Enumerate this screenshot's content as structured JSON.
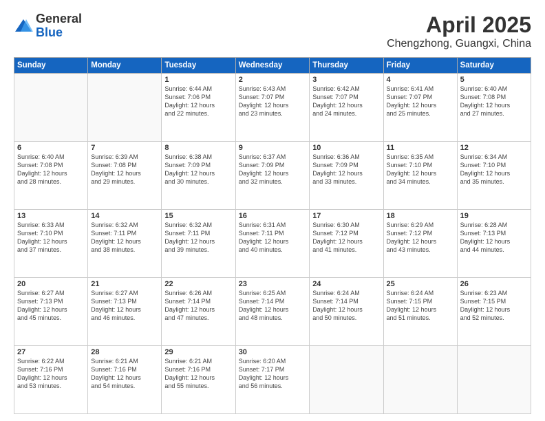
{
  "logo": {
    "general": "General",
    "blue": "Blue"
  },
  "header": {
    "month_year": "April 2025",
    "location": "Chengzhong, Guangxi, China"
  },
  "weekdays": [
    "Sunday",
    "Monday",
    "Tuesday",
    "Wednesday",
    "Thursday",
    "Friday",
    "Saturday"
  ],
  "weeks": [
    [
      {
        "day": "",
        "info": ""
      },
      {
        "day": "",
        "info": ""
      },
      {
        "day": "1",
        "info": "Sunrise: 6:44 AM\nSunset: 7:06 PM\nDaylight: 12 hours\nand 22 minutes."
      },
      {
        "day": "2",
        "info": "Sunrise: 6:43 AM\nSunset: 7:07 PM\nDaylight: 12 hours\nand 23 minutes."
      },
      {
        "day": "3",
        "info": "Sunrise: 6:42 AM\nSunset: 7:07 PM\nDaylight: 12 hours\nand 24 minutes."
      },
      {
        "day": "4",
        "info": "Sunrise: 6:41 AM\nSunset: 7:07 PM\nDaylight: 12 hours\nand 25 minutes."
      },
      {
        "day": "5",
        "info": "Sunrise: 6:40 AM\nSunset: 7:08 PM\nDaylight: 12 hours\nand 27 minutes."
      }
    ],
    [
      {
        "day": "6",
        "info": "Sunrise: 6:40 AM\nSunset: 7:08 PM\nDaylight: 12 hours\nand 28 minutes."
      },
      {
        "day": "7",
        "info": "Sunrise: 6:39 AM\nSunset: 7:08 PM\nDaylight: 12 hours\nand 29 minutes."
      },
      {
        "day": "8",
        "info": "Sunrise: 6:38 AM\nSunset: 7:09 PM\nDaylight: 12 hours\nand 30 minutes."
      },
      {
        "day": "9",
        "info": "Sunrise: 6:37 AM\nSunset: 7:09 PM\nDaylight: 12 hours\nand 32 minutes."
      },
      {
        "day": "10",
        "info": "Sunrise: 6:36 AM\nSunset: 7:09 PM\nDaylight: 12 hours\nand 33 minutes."
      },
      {
        "day": "11",
        "info": "Sunrise: 6:35 AM\nSunset: 7:10 PM\nDaylight: 12 hours\nand 34 minutes."
      },
      {
        "day": "12",
        "info": "Sunrise: 6:34 AM\nSunset: 7:10 PM\nDaylight: 12 hours\nand 35 minutes."
      }
    ],
    [
      {
        "day": "13",
        "info": "Sunrise: 6:33 AM\nSunset: 7:10 PM\nDaylight: 12 hours\nand 37 minutes."
      },
      {
        "day": "14",
        "info": "Sunrise: 6:32 AM\nSunset: 7:11 PM\nDaylight: 12 hours\nand 38 minutes."
      },
      {
        "day": "15",
        "info": "Sunrise: 6:32 AM\nSunset: 7:11 PM\nDaylight: 12 hours\nand 39 minutes."
      },
      {
        "day": "16",
        "info": "Sunrise: 6:31 AM\nSunset: 7:11 PM\nDaylight: 12 hours\nand 40 minutes."
      },
      {
        "day": "17",
        "info": "Sunrise: 6:30 AM\nSunset: 7:12 PM\nDaylight: 12 hours\nand 41 minutes."
      },
      {
        "day": "18",
        "info": "Sunrise: 6:29 AM\nSunset: 7:12 PM\nDaylight: 12 hours\nand 43 minutes."
      },
      {
        "day": "19",
        "info": "Sunrise: 6:28 AM\nSunset: 7:13 PM\nDaylight: 12 hours\nand 44 minutes."
      }
    ],
    [
      {
        "day": "20",
        "info": "Sunrise: 6:27 AM\nSunset: 7:13 PM\nDaylight: 12 hours\nand 45 minutes."
      },
      {
        "day": "21",
        "info": "Sunrise: 6:27 AM\nSunset: 7:13 PM\nDaylight: 12 hours\nand 46 minutes."
      },
      {
        "day": "22",
        "info": "Sunrise: 6:26 AM\nSunset: 7:14 PM\nDaylight: 12 hours\nand 47 minutes."
      },
      {
        "day": "23",
        "info": "Sunrise: 6:25 AM\nSunset: 7:14 PM\nDaylight: 12 hours\nand 48 minutes."
      },
      {
        "day": "24",
        "info": "Sunrise: 6:24 AM\nSunset: 7:14 PM\nDaylight: 12 hours\nand 50 minutes."
      },
      {
        "day": "25",
        "info": "Sunrise: 6:24 AM\nSunset: 7:15 PM\nDaylight: 12 hours\nand 51 minutes."
      },
      {
        "day": "26",
        "info": "Sunrise: 6:23 AM\nSunset: 7:15 PM\nDaylight: 12 hours\nand 52 minutes."
      }
    ],
    [
      {
        "day": "27",
        "info": "Sunrise: 6:22 AM\nSunset: 7:16 PM\nDaylight: 12 hours\nand 53 minutes."
      },
      {
        "day": "28",
        "info": "Sunrise: 6:21 AM\nSunset: 7:16 PM\nDaylight: 12 hours\nand 54 minutes."
      },
      {
        "day": "29",
        "info": "Sunrise: 6:21 AM\nSunset: 7:16 PM\nDaylight: 12 hours\nand 55 minutes."
      },
      {
        "day": "30",
        "info": "Sunrise: 6:20 AM\nSunset: 7:17 PM\nDaylight: 12 hours\nand 56 minutes."
      },
      {
        "day": "",
        "info": ""
      },
      {
        "day": "",
        "info": ""
      },
      {
        "day": "",
        "info": ""
      }
    ]
  ]
}
